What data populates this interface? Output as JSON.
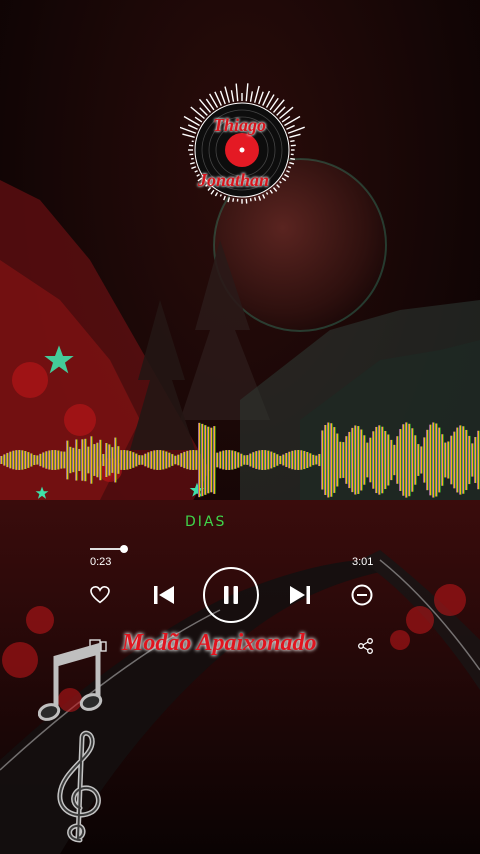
{
  "logo": {
    "line1": "Thiago",
    "line2": "Jonathan",
    "icon": "vinyl-record-icon"
  },
  "player": {
    "song_title": "DIAS",
    "elapsed": "0:23",
    "total": "3:01",
    "progress": 0.127,
    "state": "playing",
    "album_title": "Modão Apaixonado",
    "accent": "#e0141e",
    "title_color": "#3fd54a"
  },
  "controls": {
    "favorite_icon": "heart-icon",
    "previous_icon": "skip-previous-icon",
    "play_pause_icon": "pause-icon",
    "next_icon": "skip-next-icon",
    "remove_icon": "minus-circle-icon",
    "device_icon": "cast-device-icon",
    "share_icon": "share-icon"
  },
  "decorations": {
    "icons": [
      "star-icon",
      "eighth-note-icon",
      "treble-clef-icon"
    ]
  }
}
